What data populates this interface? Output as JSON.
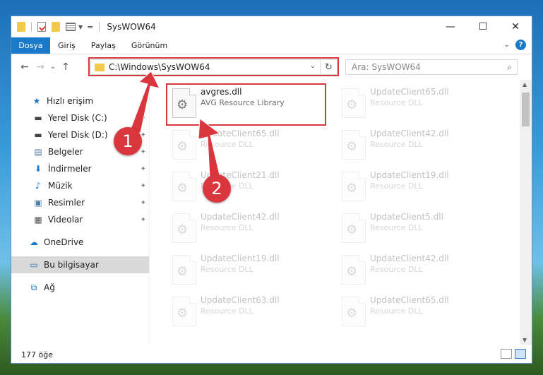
{
  "window": {
    "title": "SysWOW64",
    "controls": {
      "minimize": "—",
      "maximize": "☐",
      "close": "✕"
    }
  },
  "ribbon": {
    "tabs": [
      "Dosya",
      "Giriş",
      "Paylaş",
      "Görünüm"
    ],
    "expand_icon": "⌄",
    "help_icon": "?"
  },
  "nav": {
    "back": "←",
    "forward": "→",
    "recent": "⌄",
    "up": "↑",
    "address_path": "C:\\Windows\\SysWOW64",
    "address_dropdown": "⌄",
    "refresh_icon": "↻",
    "search_placeholder": "Ara: SysWOW64",
    "search_icon": "⌕"
  },
  "sidebar": {
    "items": [
      {
        "label": "Hızlı erişim",
        "icon": "star-icon",
        "glyph": "★",
        "color": "#1979ca",
        "pinned": false
      },
      {
        "label": "Yerel Disk (C:)",
        "icon": "drive-icon",
        "glyph": "▬",
        "color": "#444444",
        "pinned": true
      },
      {
        "label": "Yerel Disk (D:)",
        "icon": "drive-icon",
        "glyph": "▬",
        "color": "#444444",
        "pinned": true
      },
      {
        "label": "Belgeler",
        "icon": "documents-icon",
        "glyph": "▤",
        "color": "#5a7ea8",
        "pinned": true
      },
      {
        "label": "İndirmeler",
        "icon": "download-icon",
        "glyph": "⬇",
        "color": "#1979ca",
        "pinned": true
      },
      {
        "label": "Müzik",
        "icon": "music-icon",
        "glyph": "♪",
        "color": "#1979ca",
        "pinned": true
      },
      {
        "label": "Resimler",
        "icon": "pictures-icon",
        "glyph": "▣",
        "color": "#4a7fb0",
        "pinned": true
      },
      {
        "label": "Videolar",
        "icon": "videos-icon",
        "glyph": "▦",
        "color": "#555555",
        "pinned": true
      },
      {
        "label": "OneDrive",
        "icon": "cloud-icon",
        "glyph": "☁",
        "color": "#1979ca",
        "pinned": false
      },
      {
        "label": "Bu bilgisayar",
        "icon": "computer-icon",
        "glyph": "▭",
        "color": "#1979ca",
        "pinned": false,
        "selected": true
      },
      {
        "label": "Ağ",
        "icon": "network-icon",
        "glyph": "⧉",
        "color": "#1979ca",
        "pinned": false
      }
    ],
    "pin_glyph": "✦"
  },
  "files": [
    {
      "name": "avgres.dll",
      "desc": "AVG Resource Library",
      "faded": false
    },
    {
      "name": "UpdateClient65.dll",
      "desc": "Resource DLL",
      "faded": true
    },
    {
      "name": "UpdateClient65.dll",
      "desc": "Resource DLL",
      "faded": true
    },
    {
      "name": "UpdateClient42.dll",
      "desc": "Resource DLL",
      "faded": true
    },
    {
      "name": "UpdateClient21.dll",
      "desc": "Resource DLL",
      "faded": true
    },
    {
      "name": "UpdateClient19.dll",
      "desc": "Resource DLL",
      "faded": true
    },
    {
      "name": "UpdateClient42.dll",
      "desc": "Resource DLL",
      "faded": true
    },
    {
      "name": "UpdateClient5.dll",
      "desc": "Resource DLL",
      "faded": true
    },
    {
      "name": "UpdateClient19.dll",
      "desc": "Resource DLL",
      "faded": true
    },
    {
      "name": "UpdateClient42.dll",
      "desc": "Resource DLL",
      "faded": true
    },
    {
      "name": "UpdateClient63.dll",
      "desc": "Resource DLL",
      "faded": true
    },
    {
      "name": "UpdateClient65.dll",
      "desc": "Resource DLL",
      "faded": true
    }
  ],
  "file_icon_glyph": "⚙",
  "statusbar": {
    "count": "177 öğe"
  },
  "annotations": {
    "step1": "1",
    "step2": "2",
    "color": "#d9363e"
  }
}
